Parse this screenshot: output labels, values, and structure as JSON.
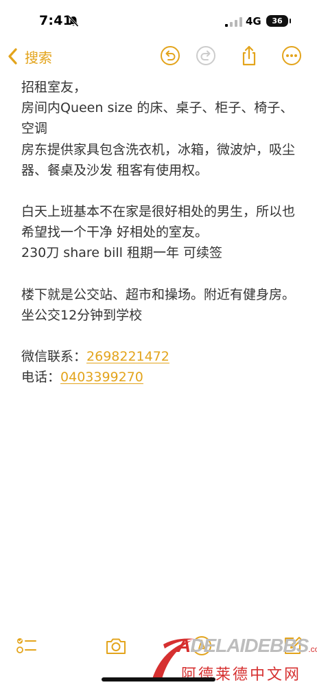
{
  "status_bar": {
    "time": "7:41",
    "network": "4G",
    "battery": "36"
  },
  "nav": {
    "back_label": "搜索"
  },
  "note": {
    "paragraphs": [
      [
        "招租室友，",
        "房间内Queen size 的床、桌子、柜子、椅子、空调",
        "房东提供家具包含洗衣机，冰箱，微波炉，吸尘器、餐桌及沙发 租客有使用权。"
      ],
      [
        "白天上班基本不在家是很好相处的男生，所以也希望找一个干净 好相处的室友。",
        "230刀 share bill  租期一年 可续签"
      ],
      [
        "楼下就是公交站、超市和操场。附近有健身房。坐公交12分钟到学校"
      ]
    ],
    "wechat_label": "微信联系：",
    "wechat_value": "2698221472",
    "phone_label": "电话：",
    "phone_value": "0403399270"
  },
  "watermark": {
    "brand_prefix": "A",
    "brand_mid": "DELAIDE",
    "brand_bbs": "BBS",
    "brand_suffix": ".com",
    "brand_cn": "阿德莱德中文网"
  },
  "colors": {
    "accent": "#E3A41C",
    "text": "#333333",
    "watermark_red": "#d63030"
  },
  "icons": [
    "bell-slash-icon",
    "signal-icon",
    "chevron-left-icon",
    "undo-icon",
    "redo-icon",
    "share-icon",
    "more-icon",
    "checklist-icon",
    "camera-icon",
    "markup-icon",
    "compose-icon"
  ]
}
